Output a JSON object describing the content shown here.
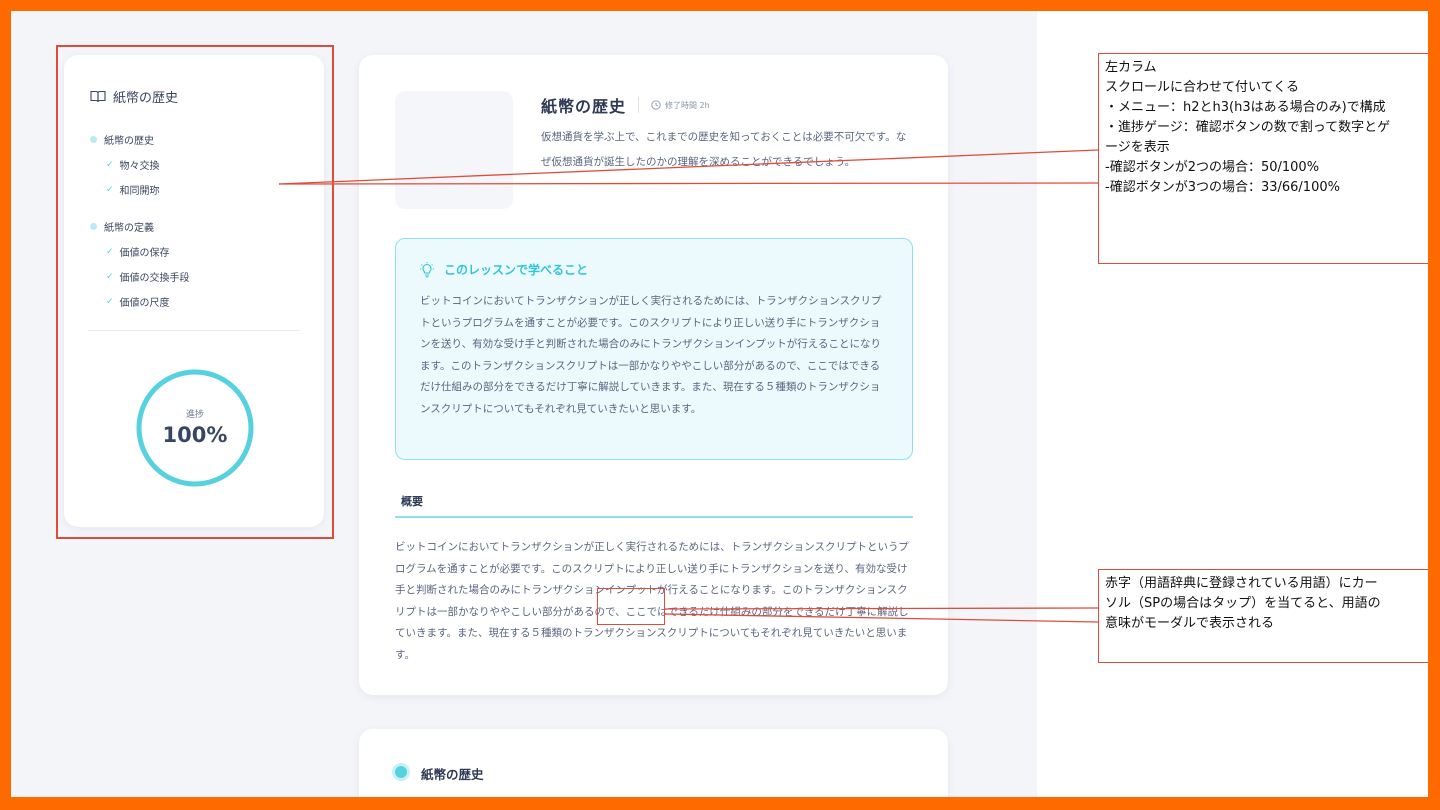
{
  "sidebar": {
    "title": "紙幣の歴史",
    "toc": [
      {
        "label": "紙幣の歴史",
        "children": [
          "物々交換",
          "和同開珎"
        ]
      },
      {
        "label": "紙幣の定義",
        "children": [
          "価値の保存",
          "価値の交換手段",
          "価値の尺度"
        ]
      }
    ],
    "progress": {
      "label": "進捗",
      "value": "100%",
      "fraction": 1.0
    }
  },
  "lesson": {
    "title": "紙幣の歴史",
    "time": "修了時間 2h",
    "description": "仮想通貨を学ぶ上で、これまでの歴史を知っておくことは必要不可欠です。なぜ仮想通貨が誕生したのかの理解を深めることができるでしょう。"
  },
  "learn_box": {
    "title": "このレッスンで学べること",
    "text": "ビットコインにおいてトランザクションが正しく実行されるためには、トランザクションスクリプトというプログラムを通すことが必要です。このスクリプトにより正しい送り手にトランザクションを送り、有効な受け手と判断された場合のみにトランザクションインプットが行えることになります。このトランザクションスクリプトは一部かなりややこしい部分があるので、ここではできるだけ仕組みの部分をできるだけ丁寧に解説していきます。また、現在する５種類のトランザクションスクリプトについてもそれぞれ見ていきたいと思います。"
  },
  "overview": {
    "heading": "概要",
    "text": "ビットコインにおいてトランザクションが正しく実行されるためには、トランザクションスクリプトというプログラムを通すことが必要です。このスクリプトにより正しい送り手にトランザクションを送り、有効な受け手と判断された場合のみにトランザクションインプットが行えることになります。このトランザクションスクリプトは一部かなりややこしい部分があるので、ここではできるだけ仕組みの部分をできるだけ丁寧に解説していきます。また、現在する５種類のトランザクションスクリプトについてもそれぞれ見ていきたいと思います。"
  },
  "next_section": {
    "title": "紙幣の歴史"
  },
  "annotations": {
    "left_column": [
      "左カラム",
      "スクロールに合わせて付いてくる",
      "",
      "・メニュー：h2とh3(h3はある場合のみ)で構成",
      "・進捗ゲージ：確認ボタンの数で割って数字とゲ",
      "ージを表示",
      "-確認ボタンが2つの場合：50/100%",
      "-確認ボタンが3つの場合：33/66/100%"
    ],
    "glossary": [
      "赤字（用語辞典に登録されている用語）にカー",
      "ソル（SPの場合はタップ）を当てると、用語の",
      "意味がモーダルで表示される"
    ]
  },
  "colors": {
    "accent": "#55d1e0",
    "annotation": "#e04c3c",
    "frame": "#ff6a00"
  }
}
